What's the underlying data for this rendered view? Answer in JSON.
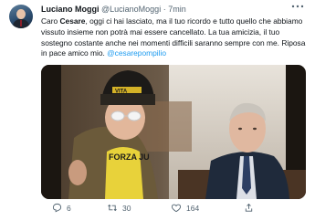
{
  "author": {
    "name": "Luciano Moggi",
    "handle": "@LucianoMoggi",
    "separator": "·",
    "time": "7min"
  },
  "tweet": {
    "text_part1": "Caro ",
    "bold_name": "Cesare",
    "text_part2": ", oggi ci hai lasciato, ma il tuo ricordo e tutto quello che abbiamo vissuto insieme non potrà mai essere cancellato. La tua amicizia, il tuo sostegno costante anche nei momenti difficili saranno sempre con me. Riposa in pace amico mio. ",
    "mention": "@cesarepompilio"
  },
  "media": {
    "alt": "photo",
    "beanie_text": "VITA",
    "shirt_text": "FORZA JU"
  },
  "actions": {
    "reply_count": "6",
    "retweet_count": "30",
    "like_count": "164"
  },
  "icons": {
    "reply": "reply-icon",
    "retweet": "retweet-icon",
    "like": "heart-icon",
    "share": "share-icon",
    "more": "more-icon"
  },
  "colors": {
    "accent": "#1d9bf0",
    "secondary_text": "#536471",
    "text": "#0f1419"
  }
}
